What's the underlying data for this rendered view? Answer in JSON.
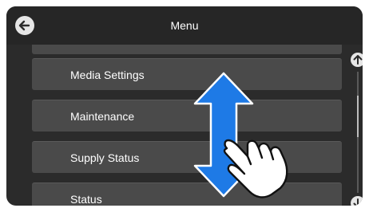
{
  "header": {
    "title": "Menu",
    "back_icon": "arrow-left-icon"
  },
  "menu": {
    "items": [
      {
        "label": ""
      },
      {
        "label": "Media Settings"
      },
      {
        "label": "Maintenance"
      },
      {
        "label": "Supply Status"
      },
      {
        "label": "Status"
      }
    ]
  },
  "scroll": {
    "up_icon": "arrow-up-icon",
    "down_icon": "arrow-down-icon"
  },
  "overlay": {
    "gesture_icon": "swipe-vertical-hand-icon",
    "arrow_color": "#1e7ae6"
  }
}
